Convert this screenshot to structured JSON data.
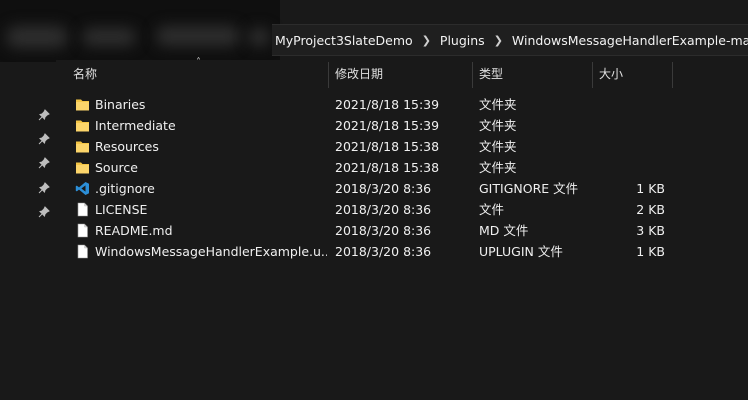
{
  "breadcrumb": [
    "MyProject3SlateDemo",
    "Plugins",
    "WindowsMessageHandlerExample-master"
  ],
  "columns": {
    "name": "名称",
    "date": "修改日期",
    "type": "类型",
    "size": "大小"
  },
  "files": [
    {
      "name": "Binaries",
      "date": "2021/8/18 15:39",
      "type": "文件夹",
      "size": "",
      "icon": "folder-icon"
    },
    {
      "name": "Intermediate",
      "date": "2021/8/18 15:39",
      "type": "文件夹",
      "size": "",
      "icon": "folder-icon"
    },
    {
      "name": "Resources",
      "date": "2021/8/18 15:38",
      "type": "文件夹",
      "size": "",
      "icon": "folder-icon"
    },
    {
      "name": "Source",
      "date": "2021/8/18 15:38",
      "type": "文件夹",
      "size": "",
      "icon": "folder-icon"
    },
    {
      "name": ".gitignore",
      "date": "2018/3/20 8:36",
      "type": "GITIGNORE 文件",
      "size": "1 KB",
      "icon": "vscode-icon"
    },
    {
      "name": "LICENSE",
      "date": "2018/3/20 8:36",
      "type": "文件",
      "size": "2 KB",
      "icon": "document-icon"
    },
    {
      "name": "README.md",
      "date": "2018/3/20 8:36",
      "type": "MD 文件",
      "size": "3 KB",
      "icon": "document-icon"
    },
    {
      "name": "WindowsMessageHandlerExample.u...",
      "date": "2018/3/20 8:36",
      "type": "UPLUGIN 文件",
      "size": "1 KB",
      "icon": "document-icon"
    }
  ],
  "colors": {
    "background": "#191919",
    "folder": "#f4c545",
    "vscode": "#2c8fd8"
  }
}
